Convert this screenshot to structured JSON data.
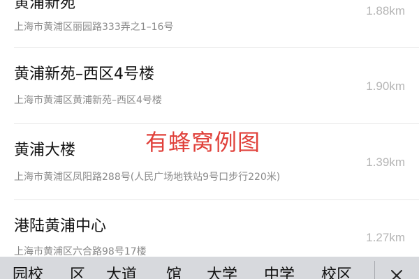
{
  "results": [
    {
      "name": "黄浦新苑",
      "address": "上海市黄浦区丽园路333弄之1–16号",
      "distance": "1.88km"
    },
    {
      "name": "黄浦新苑–西区4号楼",
      "address": "上海市黄浦区黄浦新苑–西区4号楼",
      "distance": "1.90km"
    },
    {
      "name": "黄浦大楼",
      "address": "上海市黄浦区凤阳路288号(人民广场地铁站9号口步行220米)",
      "distance": "1.39km"
    },
    {
      "name": "港陆黄浦中心",
      "address": "上海市黄浦区六合路98号17楼",
      "distance": "1.27km"
    }
  ],
  "watermark": "有蜂窝例图",
  "keyword_bar": {
    "items": [
      "园校",
      "区",
      "大道",
      "馆",
      "大学",
      "中学",
      "校区"
    ],
    "close_icon": "close-x-icon"
  },
  "colors": {
    "watermark": "#e0403a",
    "distance": "#b5b5b5",
    "address": "#8a8a8a",
    "keyword_bar_bg": "#d7d9dd"
  }
}
